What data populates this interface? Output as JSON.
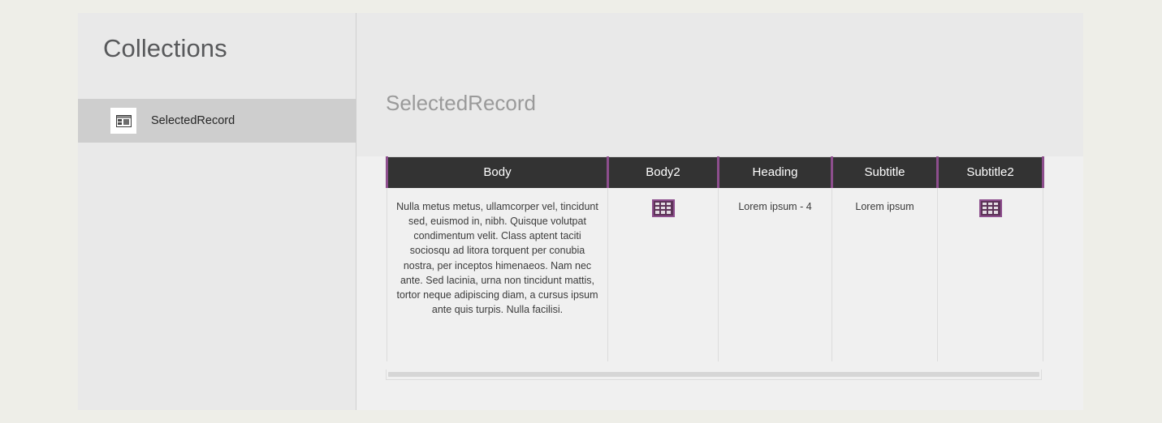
{
  "window": {
    "background_color": "#eeeee8",
    "panel_color": "#e9e9e9"
  },
  "sidebar": {
    "title": "Collections",
    "items": [
      {
        "label": "SelectedRecord",
        "icon": "record-card-icon",
        "selected": true
      }
    ]
  },
  "main": {
    "title": "SelectedRecord",
    "table": {
      "columns": [
        {
          "key": "body",
          "label": "Body"
        },
        {
          "key": "body2",
          "label": "Body2"
        },
        {
          "key": "heading",
          "label": "Heading"
        },
        {
          "key": "subtitle",
          "label": "Subtitle"
        },
        {
          "key": "subtitle2",
          "label": "Subtitle2"
        }
      ],
      "rows": [
        {
          "body": "Nulla metus metus, ullamcorper vel, tincidunt sed, euismod in, nibh. Quisque volutpat condimentum velit. Class aptent taciti sociosqu ad litora torquent per conubia nostra, per inceptos himenaeos. Nam nec ante. Sed lacinia, urna non tincidunt mattis, tortor neque adipiscing diam, a cursus ipsum ante quis turpis. Nulla facilisi.",
          "body2": "table-record-icon",
          "heading": "Lorem ipsum - 4",
          "subtitle": "Lorem ipsum",
          "subtitle2": "table-record-icon"
        }
      ],
      "header_background": "#333333",
      "header_separator_color": "#8d4e8d",
      "accent_color": "#8d4e8d"
    },
    "scrollbar": {
      "orientation": "horizontal"
    }
  }
}
